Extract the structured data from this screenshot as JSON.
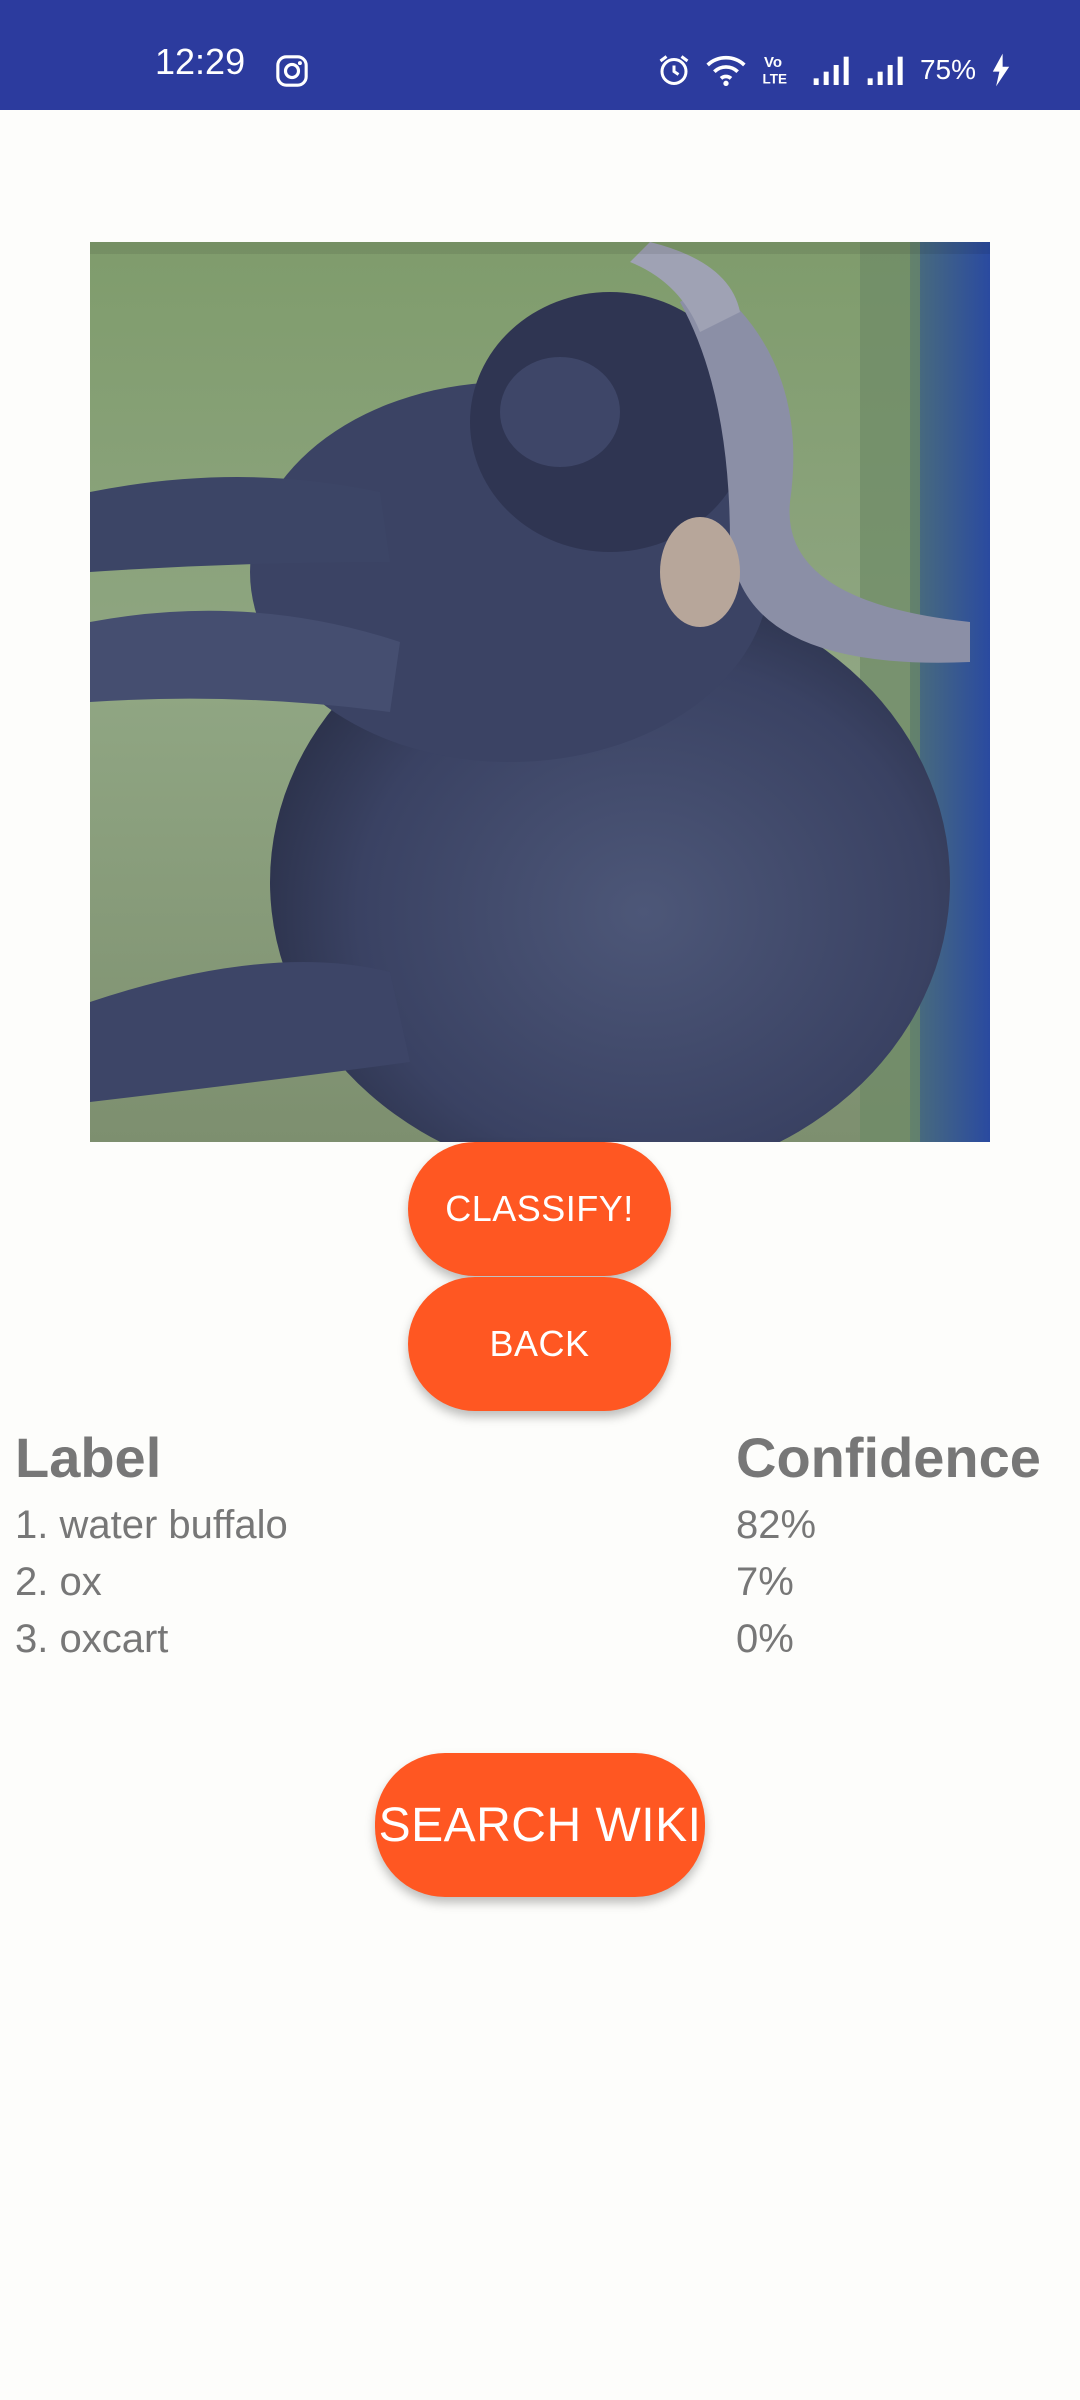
{
  "status_bar": {
    "time": "12:29",
    "battery": "75%",
    "icons": [
      "instagram-icon",
      "alarm-icon",
      "wifi-icon",
      "volte-icon",
      "signal-icon",
      "signal-icon",
      "charging-icon"
    ],
    "network_badge": "Vo LTE"
  },
  "image": {
    "icon": "water-buffalo-photo"
  },
  "buttons": {
    "classify": "CLASSIFY!",
    "back": "BACK",
    "search_wiki": "SEARCH WIKI"
  },
  "results": {
    "label_header": "Label",
    "confidence_header": "Confidence",
    "rows": [
      {
        "label": "1. water buffalo",
        "confidence": "82%"
      },
      {
        "label": "2. ox",
        "confidence": "7%"
      },
      {
        "label": "3. oxcart",
        "confidence": "0%"
      }
    ]
  },
  "colors": {
    "status_bar": "#2c3b9e",
    "accent": "#ff5722",
    "text": "#777777",
    "background": "#fdfdfb"
  }
}
